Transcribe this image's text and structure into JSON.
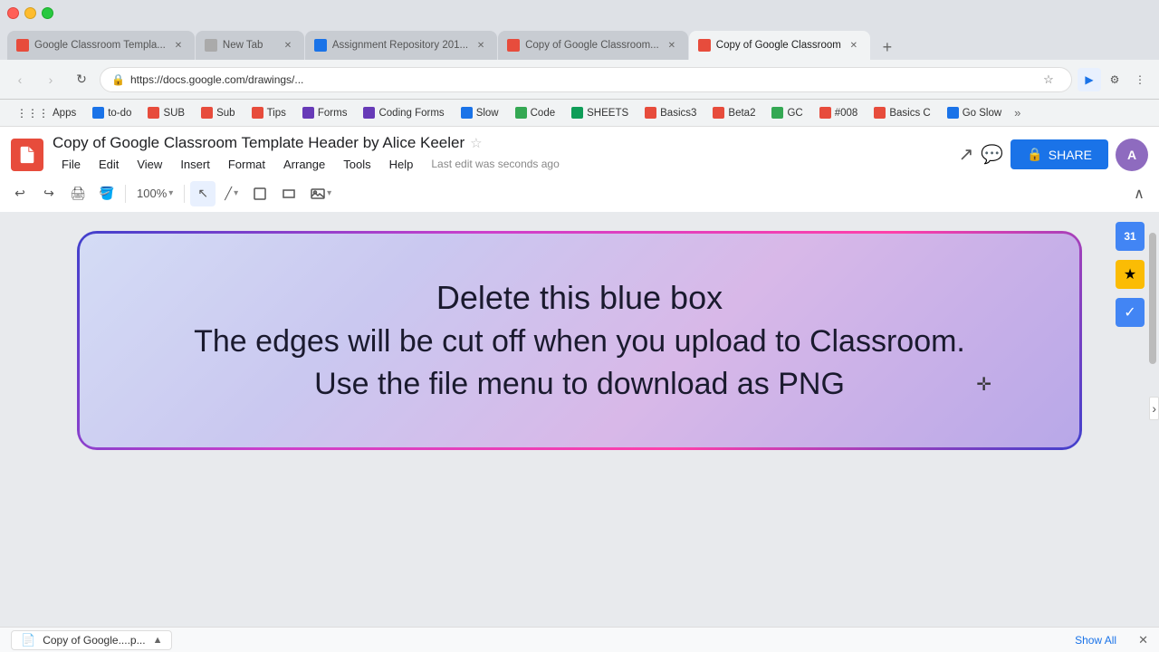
{
  "browser": {
    "tabs": [
      {
        "id": "tab1",
        "label": "Google Classroom Templa...",
        "favicon_color": "#e74c3c",
        "active": false
      },
      {
        "id": "tab2",
        "label": "New Tab",
        "favicon_color": "#aaa",
        "active": false
      },
      {
        "id": "tab3",
        "label": "Assignment Repository 201...",
        "favicon_color": "#1a73e8",
        "active": false
      },
      {
        "id": "tab4",
        "label": "Copy of Google Classroom...",
        "favicon_color": "#e74c3c",
        "active": false
      },
      {
        "id": "tab5",
        "label": "Copy of Google Classroom",
        "favicon_color": "#e74c3c",
        "active": true
      }
    ],
    "url": "https://docs.google.com/drawings/...",
    "new_tab_symbol": "+"
  },
  "bookmarks": [
    {
      "label": "Apps"
    },
    {
      "label": "to-do"
    },
    {
      "label": "SUB"
    },
    {
      "label": "Sub"
    },
    {
      "label": "Tips"
    },
    {
      "label": "Forms"
    },
    {
      "label": "Coding Forms"
    },
    {
      "label": "Slow"
    },
    {
      "label": "Code"
    },
    {
      "label": "SHEETS"
    },
    {
      "label": "Basics3"
    },
    {
      "label": "Beta2"
    },
    {
      "label": "GC"
    },
    {
      "label": "#008"
    },
    {
      "label": "Basics C"
    },
    {
      "label": "Go Slow"
    }
  ],
  "docs": {
    "logo_letter": "",
    "title": "Copy of Google Classroom Template Header by Alice Keeler",
    "last_edit": "Last edit was seconds ago",
    "menu": [
      "File",
      "Edit",
      "View",
      "Insert",
      "Format",
      "Arrange",
      "Tools",
      "Help"
    ],
    "share_label": "SHARE",
    "toolbar": {
      "undo": "↩",
      "redo": "↪",
      "print": "🖨",
      "paint": "🪣",
      "zoom_label": "100%",
      "select_tool": "↖",
      "line_tool": "╱",
      "shape_tool": "□",
      "text_tool": "▭",
      "image_tool": "🖼"
    }
  },
  "canvas": {
    "banner": {
      "line1": "Delete this blue box",
      "line2": "The edges will be cut off when you upload to Classroom.",
      "line3": "Use the file menu to download as PNG"
    }
  },
  "right_panel": {
    "icon1": "31",
    "icon2": "⭐",
    "icon3": "✓"
  },
  "bottom_bar": {
    "download_label": "Copy of Google....p...",
    "chevron": "▲",
    "show_all": "Show All",
    "close": "✕"
  }
}
